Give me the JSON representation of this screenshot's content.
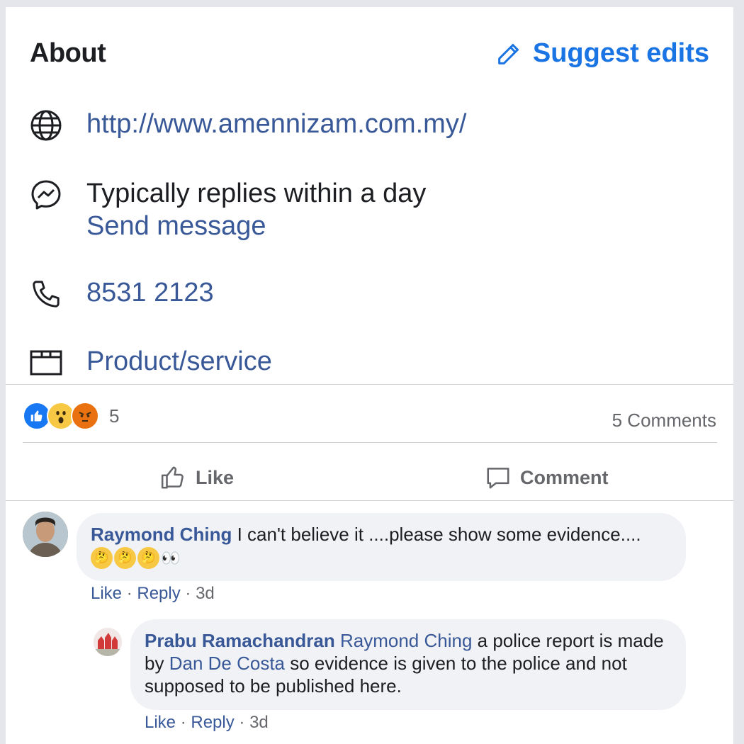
{
  "about": {
    "title": "About",
    "suggest_label": "Suggest edits",
    "website": "http://www.amennizam.com.my/",
    "response_time": "Typically replies within a day",
    "send_message": "Send message",
    "phone": "8531 2123",
    "category": "Product/service",
    "icons": [
      "globe-icon",
      "messenger-icon",
      "phone-icon",
      "category-icon"
    ]
  },
  "post": {
    "reactions_count": "5",
    "reactions": [
      "like",
      "wow",
      "angry"
    ],
    "comments_count": "5 Comments",
    "like_label": "Like",
    "comment_label": "Comment"
  },
  "comments": [
    {
      "author": "Raymond Ching",
      "text": "I can't believe it ....please show some evidence....",
      "emojis": [
        "🤔",
        "🤔",
        "🤔",
        "👀"
      ],
      "like": "Like",
      "reply": "Reply",
      "time": "3d"
    },
    {
      "author": "Prabu Ramachandran",
      "mention1": "Raymond Ching",
      "text1": "a police report is made by",
      "mention2": "Dan De Costa",
      "text2": "so evidence is given to the police and not supposed to be published here.",
      "like": "Like",
      "reply": "Reply",
      "time": "3d"
    }
  ],
  "colors": {
    "accent": "#1b74e4",
    "link": "#385898",
    "muted": "#65676b",
    "bubble": "#f0f2f5"
  }
}
